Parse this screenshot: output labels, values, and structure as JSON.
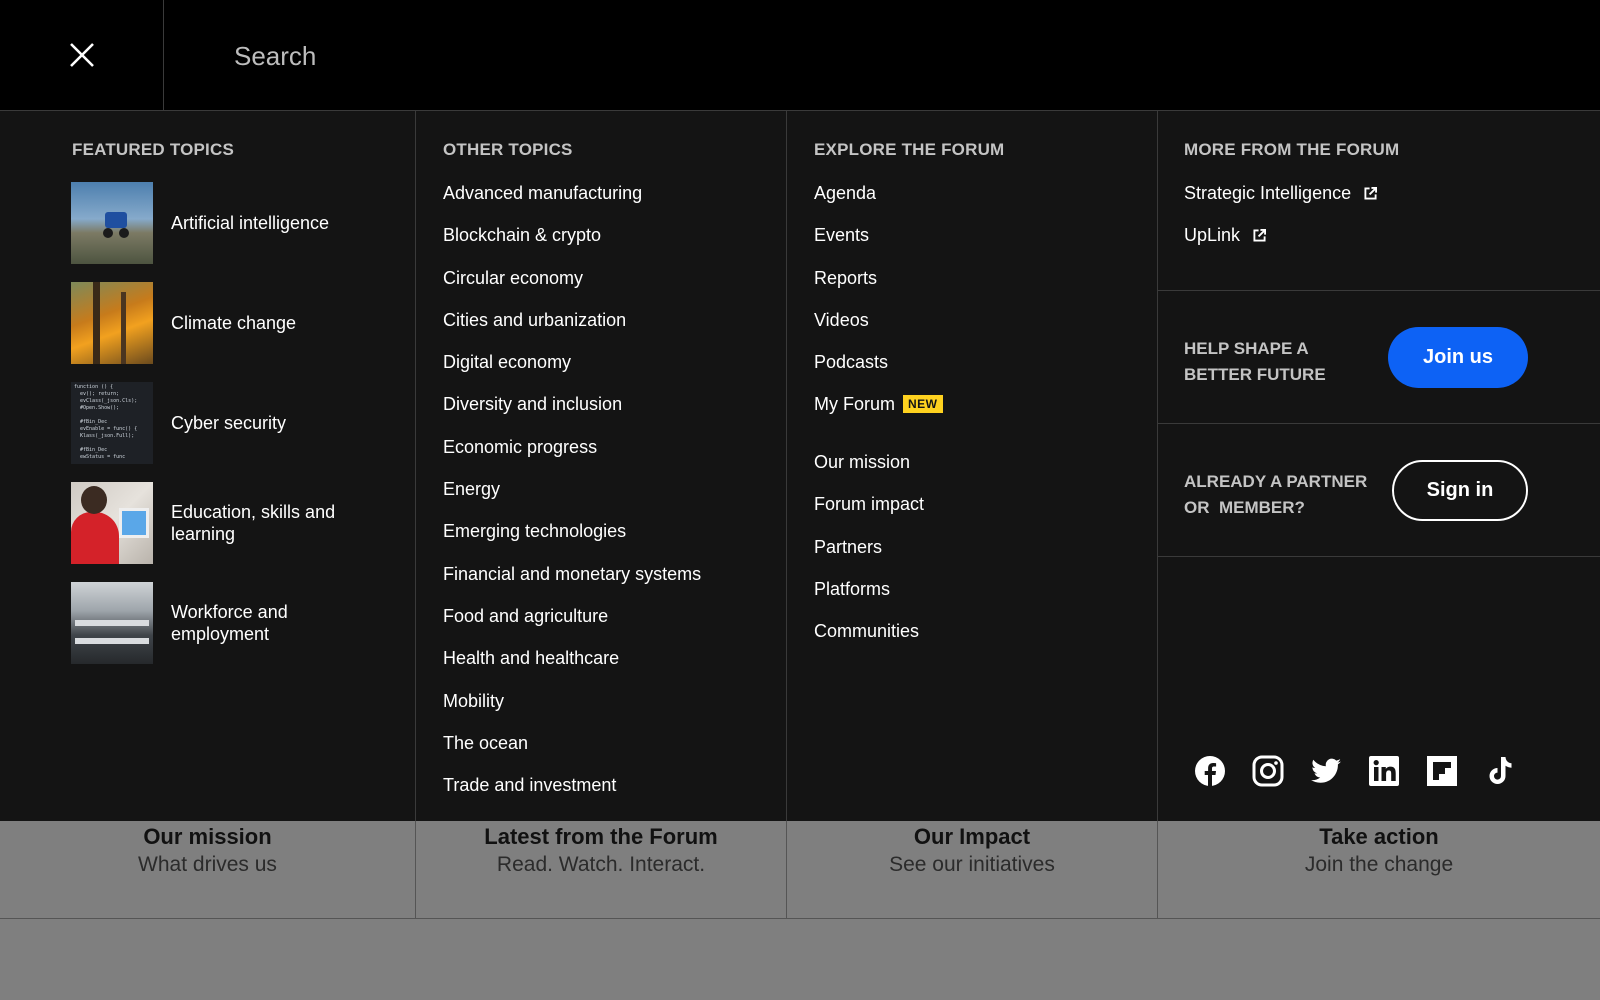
{
  "search": {
    "placeholder": "Search"
  },
  "icons": {
    "close": "close-icon",
    "external": "external-link-icon"
  },
  "colors": {
    "accent": "#0d62f5",
    "badge": "#ffd21f",
    "panel": "#141414",
    "topbar": "#000000"
  },
  "featured": {
    "heading": "FEATURED TOPICS",
    "items": [
      {
        "label": "Artificial intelligence",
        "image": "robot-field-thumbnail"
      },
      {
        "label": "Climate change",
        "image": "wildfire-trees-thumbnail"
      },
      {
        "label": "Cyber security",
        "image": "code-screen-thumbnail"
      },
      {
        "label": "Education, skills and learning",
        "image": "student-computer-thumbnail"
      },
      {
        "label": "Workforce and employment",
        "image": "office-workers-thumbnail"
      }
    ]
  },
  "other": {
    "heading": "OTHER TOPICS",
    "items": [
      "Advanced manufacturing",
      "Blockchain & crypto",
      "Circular economy",
      "Cities and urbanization",
      "Digital economy",
      "Diversity and inclusion",
      "Economic progress",
      "Energy",
      "Emerging technologies",
      "Financial and monetary systems",
      "Food and agriculture",
      "Health and healthcare",
      "Mobility",
      "The ocean",
      "Trade and investment"
    ]
  },
  "explore": {
    "heading": "EXPLORE THE FORUM",
    "items": [
      "Agenda",
      "Events",
      "Reports",
      "Videos",
      "Podcasts",
      "My Forum"
    ],
    "new_badge": "NEW",
    "items2": [
      "Our mission",
      "Forum impact",
      "Partners",
      "Platforms",
      "Communities"
    ]
  },
  "more": {
    "heading": "MORE FROM THE FORUM",
    "links": [
      "Strategic Intelligence",
      "UpLink"
    ],
    "help_line1": "HELP SHAPE A",
    "help_line2": "BETTER FUTURE",
    "join_label": "Join us",
    "partner_line1": "ALREADY A PARTNER",
    "partner_line2": "OR  MEMBER?",
    "sign_label": "Sign in",
    "social": [
      "facebook-icon",
      "instagram-icon",
      "twitter-icon",
      "linkedin-icon",
      "flipboard-icon",
      "tiktok-icon"
    ]
  },
  "tiles": [
    {
      "title": "Our mission",
      "subtitle": "What drives us"
    },
    {
      "title": "Latest from the Forum",
      "subtitle": "Read. Watch. Interact."
    },
    {
      "title": "Our Impact",
      "subtitle": "See our initiatives"
    },
    {
      "title": "Take action",
      "subtitle": "Join the change"
    }
  ]
}
